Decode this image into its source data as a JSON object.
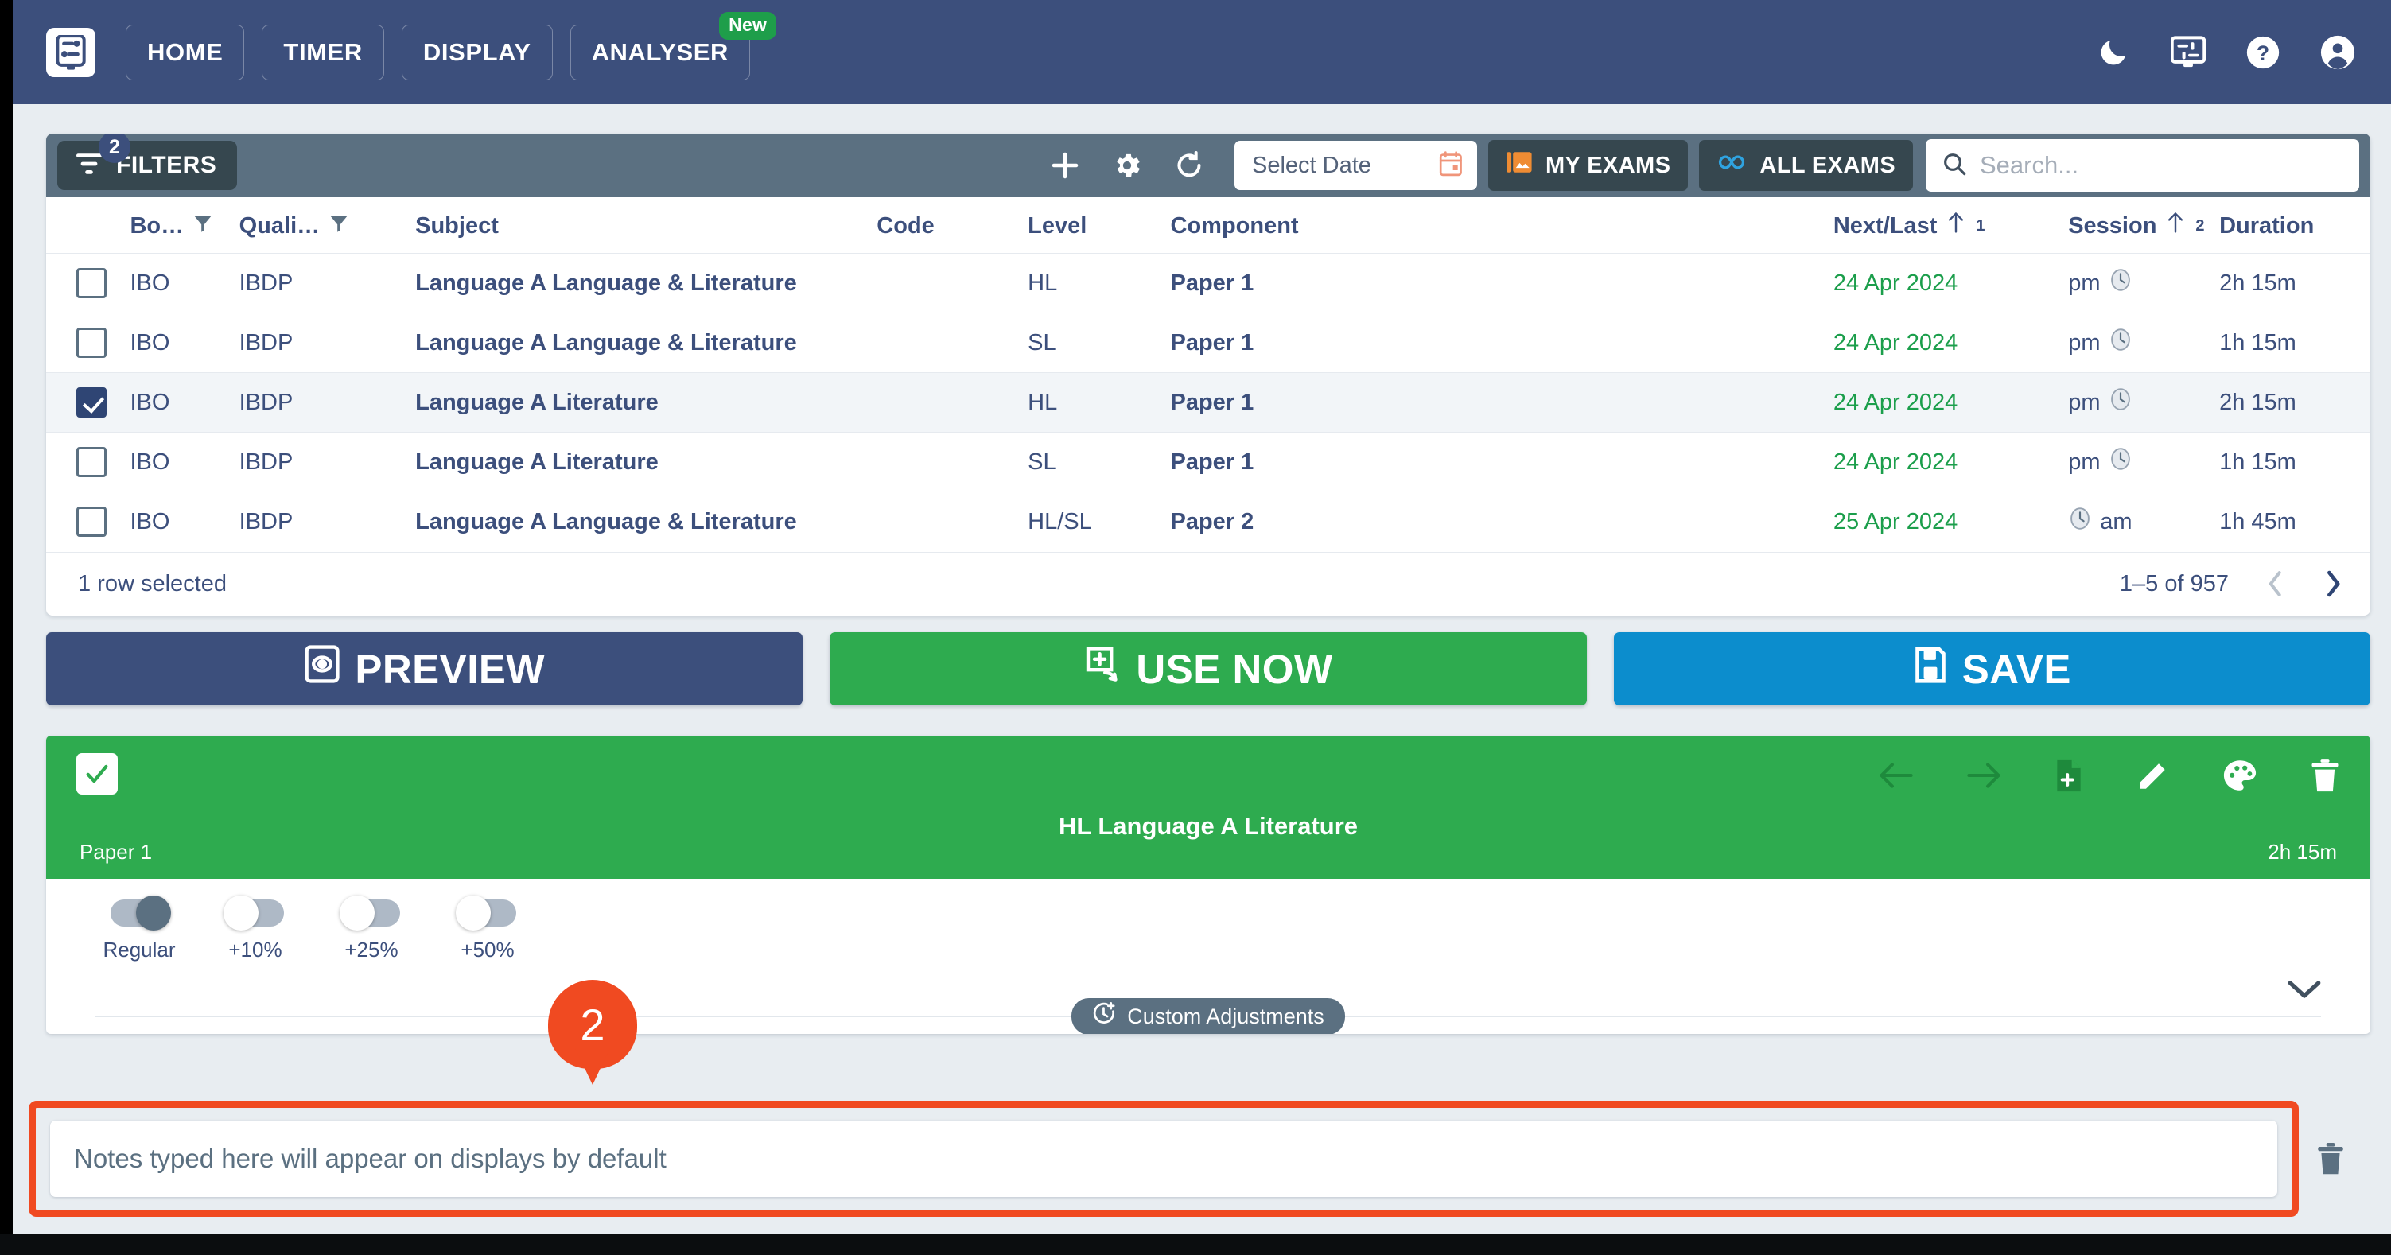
{
  "header": {
    "logo_icon": "sliders-display-icon",
    "nav": [
      {
        "label": "HOME",
        "badge": null
      },
      {
        "label": "TIMER",
        "badge": null
      },
      {
        "label": "DISPLAY",
        "badge": null
      },
      {
        "label": "ANALYSER",
        "badge": "New"
      }
    ],
    "icons": [
      "moon-icon",
      "display-settings-icon",
      "help-icon",
      "account-icon"
    ],
    "colors": {
      "bar": "#3c4f7c",
      "new_badge": "#1e9e4a"
    }
  },
  "toolbar": {
    "filters_label": "FILTERS",
    "filters_badge": "2",
    "add_icon": "plus-icon",
    "settings_icon": "gear-icon",
    "reset_icon": "refresh-icon",
    "date_placeholder": "Select Date",
    "date_icon": "calendar-icon",
    "my_exams_label": "MY EXAMS",
    "my_exams_icon": "image-stack-icon",
    "all_exams_label": "ALL EXAMS",
    "all_exams_icon": "infinity-icon",
    "search_placeholder": "Search...",
    "search_icon": "search-icon"
  },
  "table": {
    "columns": [
      {
        "key": "checkbox",
        "label": ""
      },
      {
        "key": "board",
        "label": "Bo…",
        "filter": true
      },
      {
        "key": "qualification",
        "label": "Quali…",
        "filter": true
      },
      {
        "key": "subject",
        "label": "Subject"
      },
      {
        "key": "code",
        "label": "Code"
      },
      {
        "key": "level",
        "label": "Level"
      },
      {
        "key": "component",
        "label": "Component"
      },
      {
        "key": "next_last",
        "label": "Next/Last",
        "sort": "asc",
        "sort_order": "1"
      },
      {
        "key": "session",
        "label": "Session",
        "sort": "asc",
        "sort_order": "2"
      },
      {
        "key": "duration",
        "label": "Duration"
      }
    ],
    "rows": [
      {
        "selected": false,
        "board": "IBO",
        "qualification": "IBDP",
        "subject": "Language A Language & Literature",
        "code": "",
        "level": "HL",
        "component": "Paper 1",
        "next_last": "24 Apr 2024",
        "session": "pm",
        "session_icon_side": "right",
        "duration": "2h 15m"
      },
      {
        "selected": false,
        "board": "IBO",
        "qualification": "IBDP",
        "subject": "Language A Language & Literature",
        "code": "",
        "level": "SL",
        "component": "Paper 1",
        "next_last": "24 Apr 2024",
        "session": "pm",
        "session_icon_side": "right",
        "duration": "1h 15m"
      },
      {
        "selected": true,
        "board": "IBO",
        "qualification": "IBDP",
        "subject": "Language A Literature",
        "code": "",
        "level": "HL",
        "component": "Paper 1",
        "next_last": "24 Apr 2024",
        "session": "pm",
        "session_icon_side": "right",
        "duration": "2h 15m"
      },
      {
        "selected": false,
        "board": "IBO",
        "qualification": "IBDP",
        "subject": "Language A Literature",
        "code": "",
        "level": "SL",
        "component": "Paper 1",
        "next_last": "24 Apr 2024",
        "session": "pm",
        "session_icon_side": "right",
        "duration": "1h 15m"
      },
      {
        "selected": false,
        "board": "IBO",
        "qualification": "IBDP",
        "subject": "Language A Language & Literature",
        "code": "",
        "level": "HL/SL",
        "component": "Paper 2",
        "next_last": "25 Apr 2024",
        "session": "am",
        "session_icon_side": "left",
        "duration": "1h 45m"
      }
    ],
    "footer": {
      "selection_text": "1 row selected",
      "range_text": "1–5 of 957",
      "prev_icon": "chevron-left-icon",
      "next_icon": "chevron-right-icon"
    }
  },
  "actions": [
    {
      "label": "PREVIEW",
      "icon": "preview-eye-icon",
      "color": "#3c4f7c"
    },
    {
      "label": "USE NOW",
      "icon": "use-now-icon",
      "color": "#2eab4f"
    },
    {
      "label": "SAVE",
      "icon": "save-disk-icon",
      "color": "#0c8dcd"
    }
  ],
  "exam_card": {
    "checked": true,
    "title": "HL Language A Literature",
    "component": "Paper 1",
    "duration": "2h 15m",
    "accent_color": "#2eab4f",
    "icons": [
      {
        "name": "arrow-left-icon",
        "dim": false
      },
      {
        "name": "arrow-right-icon",
        "dim": false
      },
      {
        "name": "add-document-icon",
        "dim": true
      },
      {
        "name": "edit-pencil-icon",
        "dim": false
      },
      {
        "name": "palette-icon",
        "dim": false
      },
      {
        "name": "delete-trash-icon",
        "dim": false
      }
    ],
    "toggles": [
      {
        "label": "Regular",
        "on": true
      },
      {
        "label": "+10%",
        "on": false
      },
      {
        "label": "+25%",
        "on": false
      },
      {
        "label": "+50%",
        "on": false
      }
    ],
    "custom_pill": {
      "label": "Custom Adjustments",
      "icon": "clock-plus-icon"
    },
    "expand_icon": "chevron-down-icon"
  },
  "notes": {
    "placeholder": "Notes typed here will appear on displays by default",
    "value": "",
    "trash_icon": "delete-trash-icon",
    "highlight_color": "#f04a21"
  },
  "marker": {
    "label": "2",
    "color": "#f04a21"
  }
}
